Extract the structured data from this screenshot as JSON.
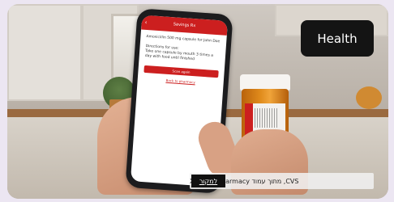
{
  "badge": {
    "label": "Health"
  },
  "credit": {
    "text": "CVS, מתוך עמוד CVS Pharmacy ב-X",
    "source_link": "למקור"
  },
  "phone_app": {
    "header_title": "Savings Rx",
    "back_glyph": "‹",
    "rx_title": "Amoxicillin 500 mg capsule for John Doe",
    "directions_label": "Directions for use:",
    "directions_text": "Take one capsule by mouth 3 times a day with food until finished",
    "primary_button": "Scan again",
    "back_link": "Back to pharmacy"
  },
  "colors": {
    "brand_red": "#cc1f1f",
    "badge_bg": "#141414",
    "bottle_orange": "#e08b1c"
  }
}
